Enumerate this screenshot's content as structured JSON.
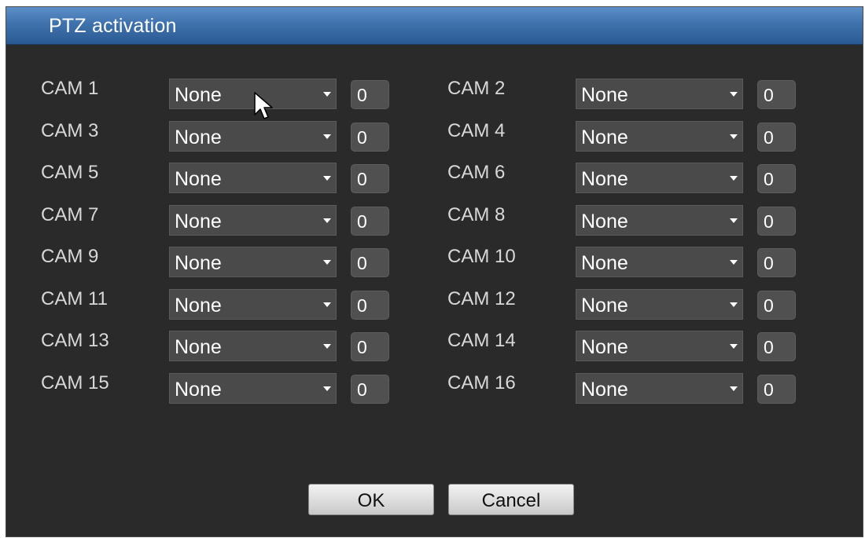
{
  "dialog": {
    "title": "PTZ activation"
  },
  "cameras": [
    {
      "label": "CAM 1",
      "select": "None",
      "value": "0"
    },
    {
      "label": "CAM 2",
      "select": "None",
      "value": "0"
    },
    {
      "label": "CAM 3",
      "select": "None",
      "value": "0"
    },
    {
      "label": "CAM 4",
      "select": "None",
      "value": "0"
    },
    {
      "label": "CAM 5",
      "select": "None",
      "value": "0"
    },
    {
      "label": "CAM 6",
      "select": "None",
      "value": "0"
    },
    {
      "label": "CAM 7",
      "select": "None",
      "value": "0"
    },
    {
      "label": "CAM 8",
      "select": "None",
      "value": "0"
    },
    {
      "label": "CAM 9",
      "select": "None",
      "value": "0"
    },
    {
      "label": "CAM 10",
      "select": "None",
      "value": "0"
    },
    {
      "label": "CAM 11",
      "select": "None",
      "value": "0"
    },
    {
      "label": "CAM 12",
      "select": "None",
      "value": "0"
    },
    {
      "label": "CAM 13",
      "select": "None",
      "value": "0"
    },
    {
      "label": "CAM 14",
      "select": "None",
      "value": "0"
    },
    {
      "label": "CAM 15",
      "select": "None",
      "value": "0"
    },
    {
      "label": "CAM 16",
      "select": "None",
      "value": "0"
    }
  ],
  "buttons": {
    "ok_label": "OK",
    "cancel_label": "Cancel"
  },
  "icons": {
    "dropdown": "chevron-down-icon",
    "cursor": "mouse-pointer-icon"
  },
  "colors": {
    "titlebar": "#3f72ad",
    "background": "#2a2a2a",
    "field": "#4a4a4a",
    "text": "#d8d8d8"
  }
}
